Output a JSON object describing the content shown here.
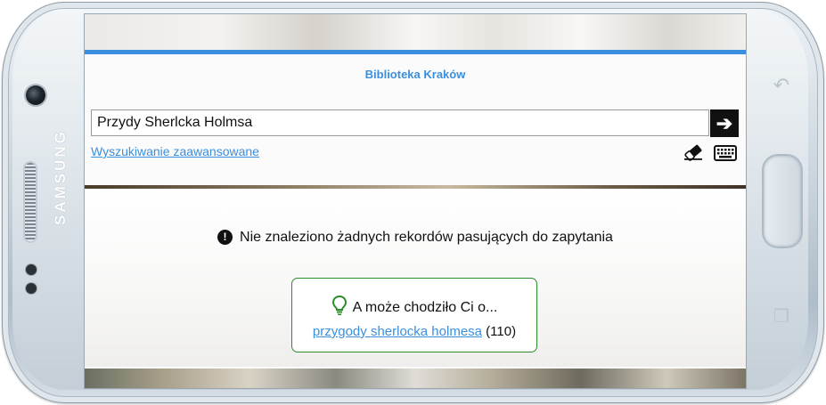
{
  "device": {
    "brand": "SAMSUNG"
  },
  "header": {
    "library_name": "Biblioteka Kraków"
  },
  "search": {
    "value": "Przydy Sherlcka Holmsa",
    "submit_icon": "arrow-right-icon",
    "advanced_link": "Wyszukiwanie zaawansowane",
    "clear_icon": "eraser-icon",
    "keyboard_icon": "keyboard-icon"
  },
  "results": {
    "message": "Nie znaleziono żadnych rekordów pasujących do zapytania",
    "message_icon": "exclamation-circle-icon"
  },
  "suggestion": {
    "heading": "A może chodziło Ci o...",
    "icon": "lightbulb-icon",
    "link_text": "przygody sherlocka holmesa",
    "count": "(110)"
  },
  "colors": {
    "accent": "#3a8fde",
    "suggestion_border": "#2e8b2e"
  }
}
